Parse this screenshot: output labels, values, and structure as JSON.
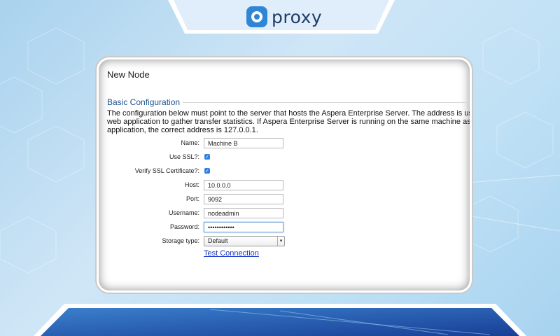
{
  "brand": {
    "name": "proxy",
    "logo_glyph": "9"
  },
  "page": {
    "title": "New Node"
  },
  "section": {
    "title": "Basic Configuration",
    "description_lines": [
      "The configuration below must point to the server that hosts the Aspera Enterprise Server. The address is us",
      "web application to gather transfer statistics. If Aspera Enterprise Server is running on the same machine as",
      "application, the correct address is 127.0.0.1."
    ]
  },
  "form": {
    "name": {
      "label": "Name:",
      "value": "Machine B"
    },
    "use_ssl": {
      "label": "Use SSL?:",
      "checked": true
    },
    "verify_ssl": {
      "label": "Verify SSL Certificate?:",
      "checked": true
    },
    "host": {
      "label": "Host:",
      "value": "10.0.0.0"
    },
    "port": {
      "label": "Port:",
      "value": "9092"
    },
    "username": {
      "label": "Username:",
      "value": "nodeadmin"
    },
    "password": {
      "label": "Password:",
      "value": "••••••••••••"
    },
    "storage_type": {
      "label": "Storage type:",
      "value": "Default"
    },
    "test_connection": "Test Connection"
  },
  "colors": {
    "accent": "#2f86d6",
    "brand_text": "#1f3d66",
    "section_title": "#1a4f8f",
    "link": "#1a36c9",
    "checkbox": "#2f7fe0"
  },
  "icons": {
    "logo": "proxy-logo-icon",
    "select_arrow": "chevron-down-icon",
    "checkbox": "checkmark-icon"
  }
}
